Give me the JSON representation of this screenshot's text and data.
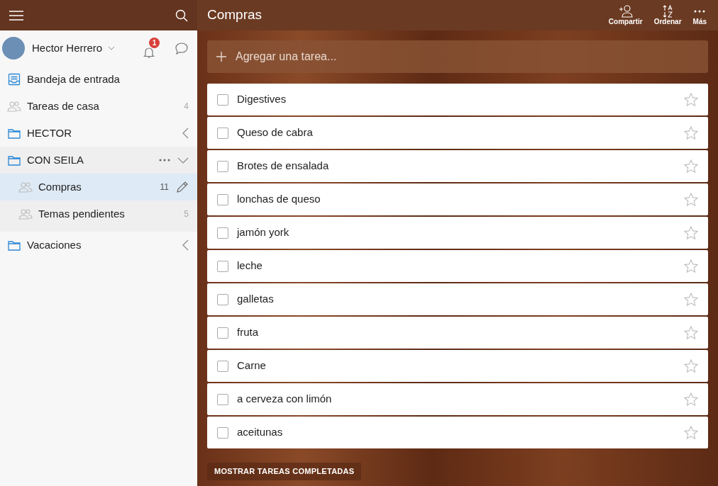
{
  "sidebar": {
    "user": {
      "name": "Hector Herrero",
      "notifications": "1"
    },
    "items": [
      {
        "kind": "inbox",
        "label": "Bandeja de entrada",
        "selected": false
      },
      {
        "kind": "list",
        "label": "Tareas de casa",
        "count": "4",
        "selected": false
      },
      {
        "kind": "folder",
        "label": "HECTOR",
        "expanded": false,
        "selected": false
      },
      {
        "kind": "folder",
        "label": "CON SEILA",
        "expanded": true,
        "selected": false,
        "children": [
          {
            "kind": "list",
            "label": "Compras",
            "count": "11",
            "selected": true
          },
          {
            "kind": "list",
            "label": "Temas pendientes",
            "count": "5",
            "selected": false
          }
        ]
      },
      {
        "kind": "folder",
        "label": "Vacaciones",
        "expanded": false,
        "selected": false
      }
    ]
  },
  "header": {
    "title": "Compras",
    "actions": [
      {
        "kind": "share",
        "label": "Compartir"
      },
      {
        "kind": "sort",
        "label": "Ordenar"
      },
      {
        "kind": "more",
        "label": "Más"
      }
    ]
  },
  "add_task": {
    "placeholder": "Agregar una tarea..."
  },
  "tasks": [
    {
      "title": "Digestives",
      "checked": false,
      "starred": false
    },
    {
      "title": "Queso de cabra",
      "checked": false,
      "starred": false
    },
    {
      "title": "Brotes de ensalada",
      "checked": false,
      "starred": false
    },
    {
      "title": "lonchas de queso",
      "checked": false,
      "starred": false
    },
    {
      "title": "jamón york",
      "checked": false,
      "starred": false
    },
    {
      "title": "leche",
      "checked": false,
      "starred": false
    },
    {
      "title": "galletas",
      "checked": false,
      "starred": false
    },
    {
      "title": "fruta",
      "checked": false,
      "starred": false
    },
    {
      "title": "Carne",
      "checked": false,
      "starred": false
    },
    {
      "title": "a cerveza con limón",
      "checked": false,
      "starred": false
    },
    {
      "title": "aceitunas",
      "checked": false,
      "starred": false
    }
  ],
  "show_completed": "MOSTRAR TAREAS COMPLETADAS"
}
